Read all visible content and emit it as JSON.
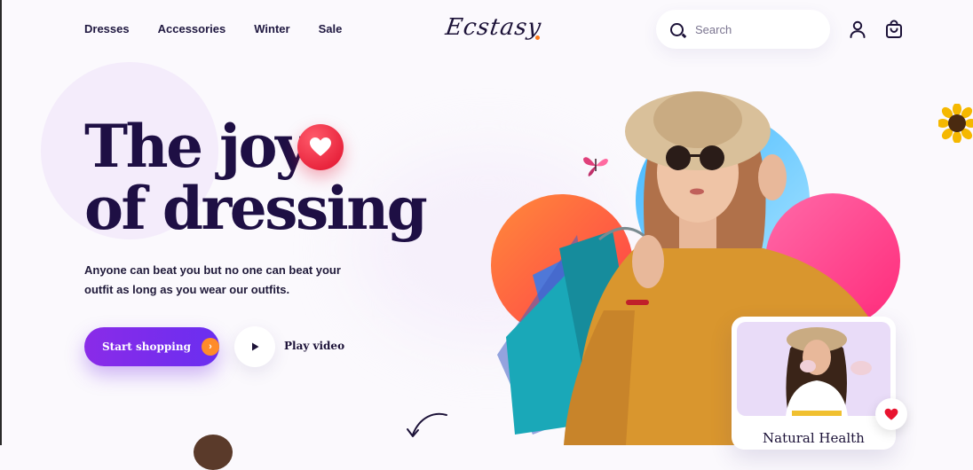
{
  "nav": {
    "items": [
      {
        "label": "Dresses"
      },
      {
        "label": "Accessories"
      },
      {
        "label": "Winter"
      },
      {
        "label": "Sale"
      }
    ]
  },
  "brand": {
    "name": "Ecstasy",
    "accent": "#ff7a1a"
  },
  "search": {
    "placeholder": "Search",
    "icon": "search-icon"
  },
  "header_icons": [
    "user-icon",
    "shopping-bag-icon"
  ],
  "hero": {
    "headline_line1": "The joy",
    "headline_line2": "of dressing",
    "subtext": "Anyone can beat you but no one can beat your outfit as long as you wear our outfits.",
    "cta_label": "Start shopping",
    "cta_icon": "chevron-right-icon",
    "play_label": "Play video",
    "badge_icon": "heart-icon"
  },
  "card": {
    "title": "Natural Health",
    "icon": "heart-icon"
  },
  "colors": {
    "primary": "#7b2ff0",
    "heading": "#1e0f44",
    "heart": "#e8132f",
    "orange": "#ff8a3a",
    "blue": "#3fb6ff",
    "pink": "#ff3a86"
  }
}
